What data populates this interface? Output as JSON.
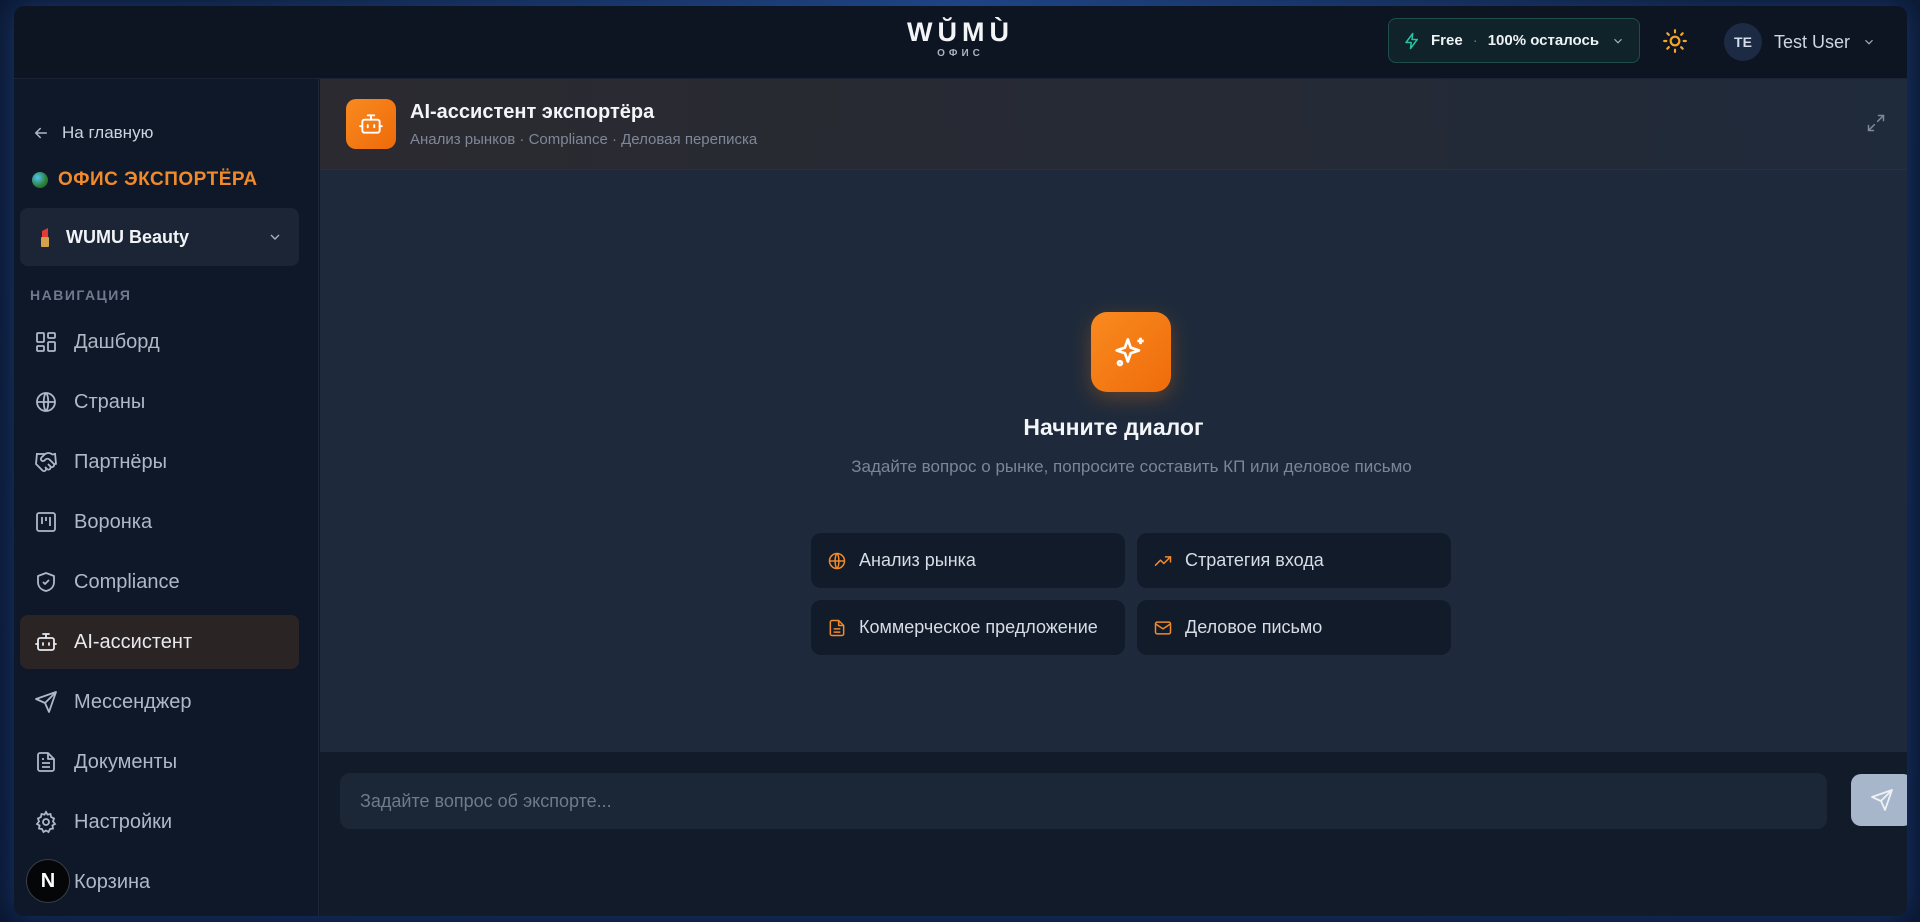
{
  "header": {
    "logo": "WŬMÙ",
    "logo_sub": "ОФИС",
    "plan": {
      "name": "Free",
      "remaining": "100% осталось"
    },
    "user": {
      "initials": "TE",
      "name": "Test User"
    }
  },
  "sidebar": {
    "back_label": "На главную",
    "office_title": "ОФИС ЭКСПОРТЁРА",
    "company": "WUMU Beauty",
    "nav_caption": "НАВИГАЦИЯ",
    "items": [
      {
        "label": "Дашборд",
        "icon": "dashboard-icon"
      },
      {
        "label": "Страны",
        "icon": "globe-icon"
      },
      {
        "label": "Партнёры",
        "icon": "handshake-icon"
      },
      {
        "label": "Воронка",
        "icon": "kanban-icon"
      },
      {
        "label": "Compliance",
        "icon": "shield-check-icon"
      },
      {
        "label": "AI-ассистент",
        "icon": "bot-icon",
        "active": true
      },
      {
        "label": "Мессенджер",
        "icon": "send-icon"
      },
      {
        "label": "Документы",
        "icon": "document-icon"
      },
      {
        "label": "Настройки",
        "icon": "gear-icon"
      },
      {
        "label": "Корзина",
        "icon": "trash-icon"
      }
    ],
    "n_badge": "N"
  },
  "chat": {
    "title": "AI-ассистент экспортёра",
    "subtitle": "Анализ рынков · Compliance · Деловая переписка",
    "empty_title": "Начните диалог",
    "empty_subtitle": "Задайте вопрос о рынке, попросите составить КП или деловое письмо",
    "suggestions": [
      {
        "label": "Анализ рынка",
        "icon": "globe-icon"
      },
      {
        "label": "Стратегия входа",
        "icon": "trending-up-icon"
      },
      {
        "label": "Коммерческое предложение",
        "icon": "document-icon"
      },
      {
        "label": "Деловое письмо",
        "icon": "mail-icon"
      }
    ],
    "input_placeholder": "Задайте вопрос об экспорте..."
  },
  "colors": {
    "accent": "#f08a2a",
    "background": "#0f1828",
    "main": "#1e2a3b"
  }
}
